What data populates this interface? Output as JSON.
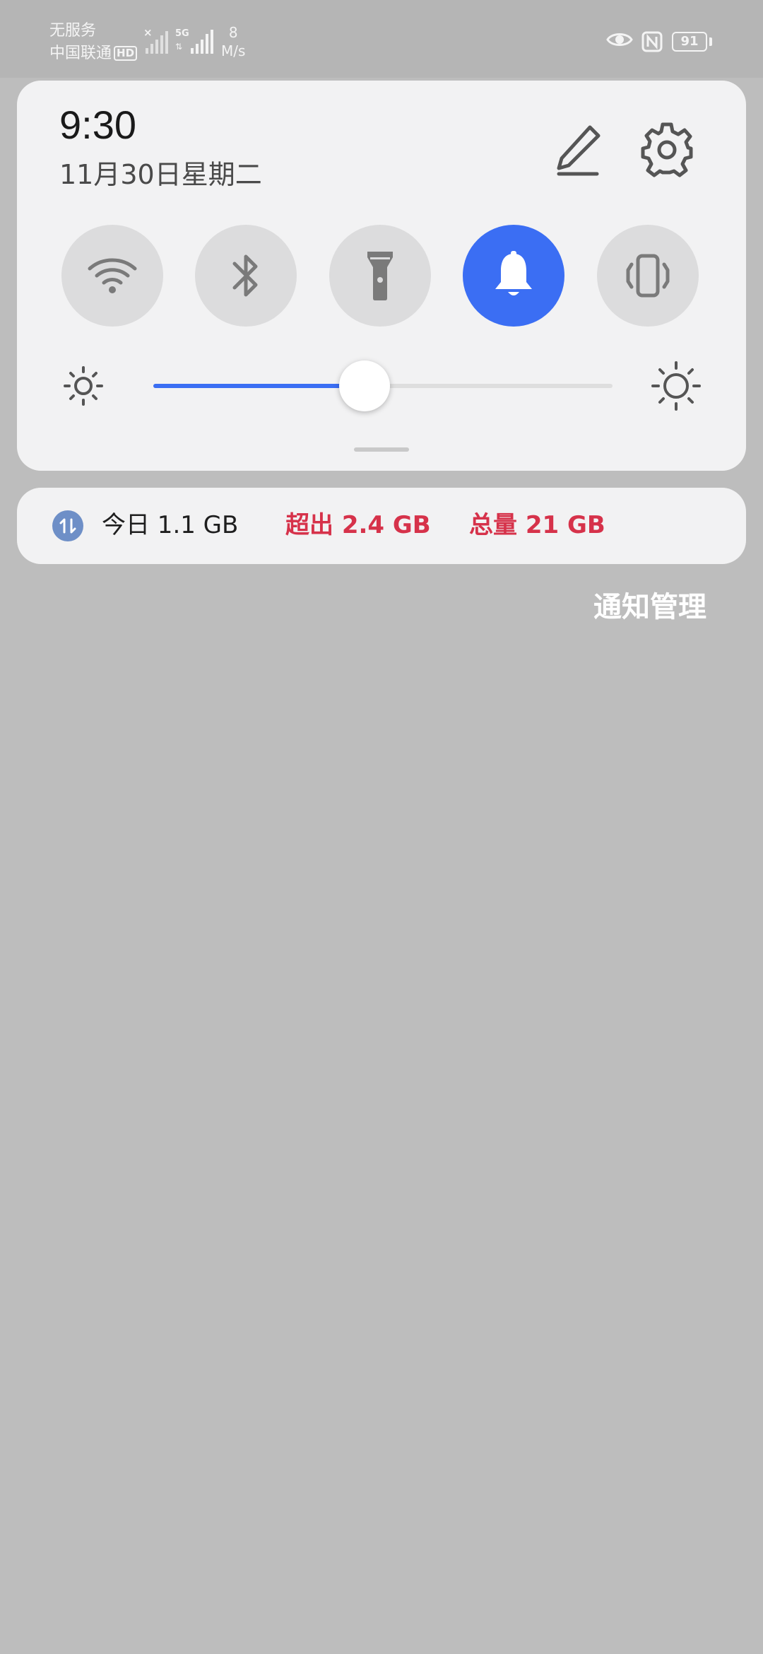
{
  "status_bar": {
    "carrier_line1": "无服务",
    "carrier_line2": "中国联通",
    "hd_badge": "HD",
    "network_type": "5G",
    "speed_value": "8",
    "speed_unit": "M/s",
    "battery_level": "91"
  },
  "panel": {
    "time": "9:30",
    "date": "11月30日星期二",
    "toggles": [
      {
        "name": "wifi",
        "icon": "wifi-icon",
        "active": false
      },
      {
        "name": "bluetooth",
        "icon": "bluetooth-icon",
        "active": false
      },
      {
        "name": "flashlight",
        "icon": "flashlight-icon",
        "active": false
      },
      {
        "name": "sound",
        "icon": "bell-icon",
        "active": true
      },
      {
        "name": "vibration",
        "icon": "vibrate-icon",
        "active": false
      }
    ],
    "brightness_level": 0.46
  },
  "data_usage": {
    "today": "今日 1.1 GB",
    "over": "超出 2.4 GB",
    "total": "总量 21 GB"
  },
  "notification_management": "通知管理",
  "colors": {
    "accent": "#3b6ef3",
    "warning": "#d6324a",
    "panel_bg": "#f2f2f3",
    "page_bg": "#bdbdbd"
  }
}
